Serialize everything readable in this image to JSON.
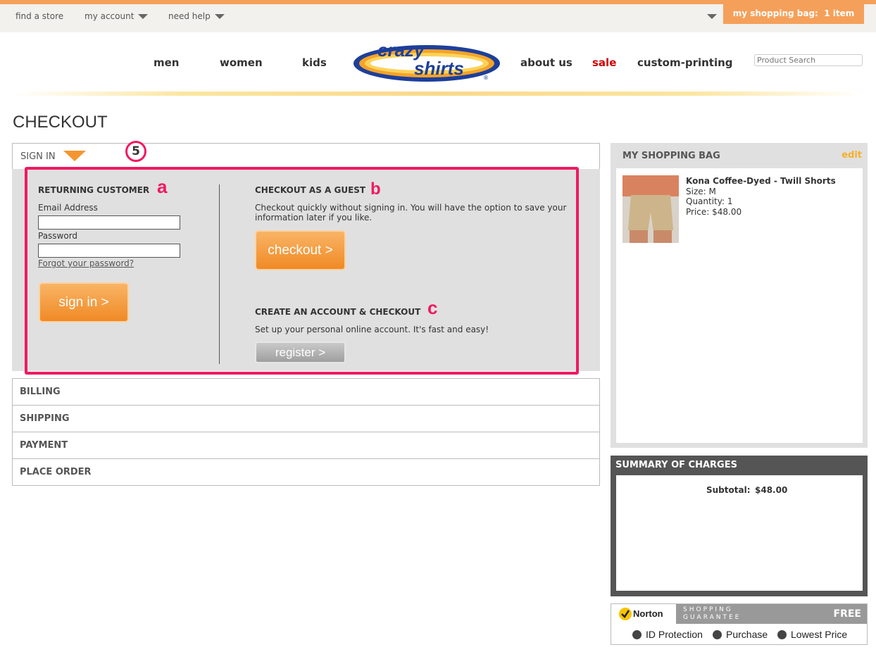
{
  "topbar": {
    "find_store": "find a store",
    "my_account": "my account",
    "need_help": "need help",
    "bag_label": "my shopping bag:",
    "bag_count": "1 item"
  },
  "nav": {
    "men": "men",
    "women": "women",
    "kids": "kids",
    "about_us": "about us",
    "sale": "sale",
    "custom_printing": "custom-printing"
  },
  "logo": {
    "line1": "crazy",
    "line2": "shirts",
    "reg": "®"
  },
  "search": {
    "placeholder": "Product Search"
  },
  "page_title": "CHECKOUT",
  "signin": {
    "label": "SIGN IN",
    "step_badge": "5",
    "returning": {
      "heading": "RETURNING CUSTOMER",
      "badge": "a",
      "email_label": "Email Address",
      "email_value": "",
      "password_label": "Password",
      "password_value": "",
      "forgot": "Forgot your password?",
      "button": "sign in >"
    },
    "guest": {
      "heading": "CHECKOUT AS A GUEST",
      "badge": "b",
      "text": "Checkout quickly without signing in. You will have the option to save your information later if you like.",
      "button": "checkout >"
    },
    "create": {
      "heading": "CREATE AN ACCOUNT & CHECKOUT",
      "badge": "c",
      "text": "Set up your personal online account. It's fast and easy!",
      "button": "register >"
    }
  },
  "sections": [
    "BILLING",
    "SHIPPING",
    "PAYMENT",
    "PLACE ORDER"
  ],
  "bag": {
    "title": "MY SHOPPING BAG",
    "edit": "edit",
    "item": {
      "name": "Kona Coffee-Dyed - Twill Shorts",
      "size": "Size: M",
      "quantity": "Quantity: 1",
      "price": "Price: $48.00"
    }
  },
  "summary": {
    "title": "SUMMARY OF CHARGES",
    "subtotal_label": "Subtotal:",
    "subtotal_value": "$48.00"
  },
  "norton": {
    "brand": "Norton",
    "guarantee_line1": "SHOPPING",
    "guarantee_line2": "GUARANTEE",
    "free": "FREE",
    "id_protection": "ID Protection",
    "purchase": "Purchase",
    "lowest_price": "Lowest Price"
  },
  "colors": {
    "accent_orange": "#f5a05a",
    "highlight_pink": "#f0195f",
    "sale_red": "#cc0000"
  }
}
